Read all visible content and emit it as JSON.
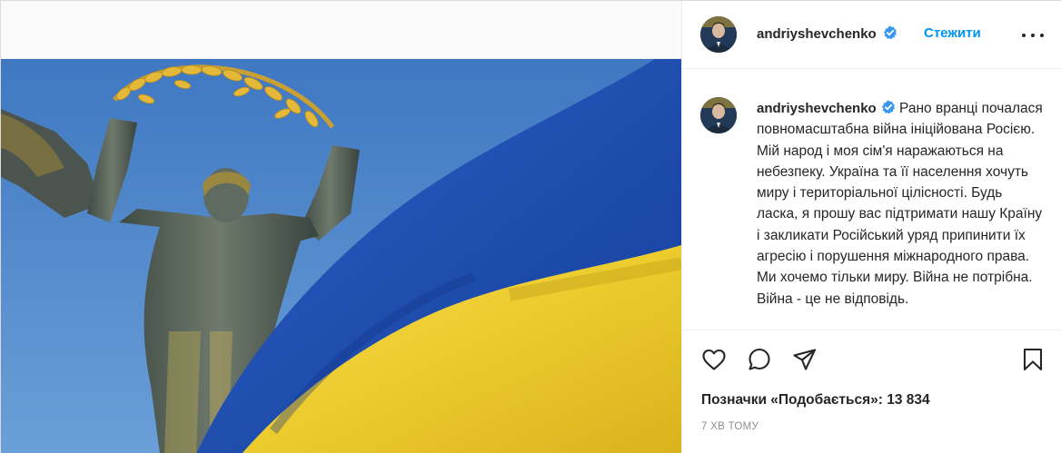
{
  "post": {
    "author": {
      "username": "andriyshevchenko",
      "verified": true,
      "follow_label": "Стежити"
    },
    "caption": {
      "username": "andriyshevchenko",
      "text": "Рано вранці почалася повномасштабна війна ініційована Росією. Мій народ і моя сім'я наражаються на небезпеку. Україна та її населення хочуть миру і територіальної цілісності. Будь ласка, я прошу вас підтримати нашу Країну і закликати Російський уряд припинити їх агресію і порушення міжнародного права. Ми хочемо тільки миру. Війна не потрібна. Війна - це не відповідь."
    },
    "likes_text": "Позначки «Подобається»: 13 834",
    "timestamp": "7 ХВ ТОМУ",
    "icons": {
      "like": "heart-icon",
      "comment": "comment-icon",
      "share": "share-icon",
      "save": "bookmark-icon",
      "more": "more-options-icon",
      "verified": "verified-badge-icon"
    },
    "colors": {
      "link_blue": "#0095f6",
      "verified_blue": "#3897f0",
      "flag_blue": "#1d50b8",
      "flag_yellow": "#f2d33a",
      "sky": "#4a82c9"
    }
  }
}
